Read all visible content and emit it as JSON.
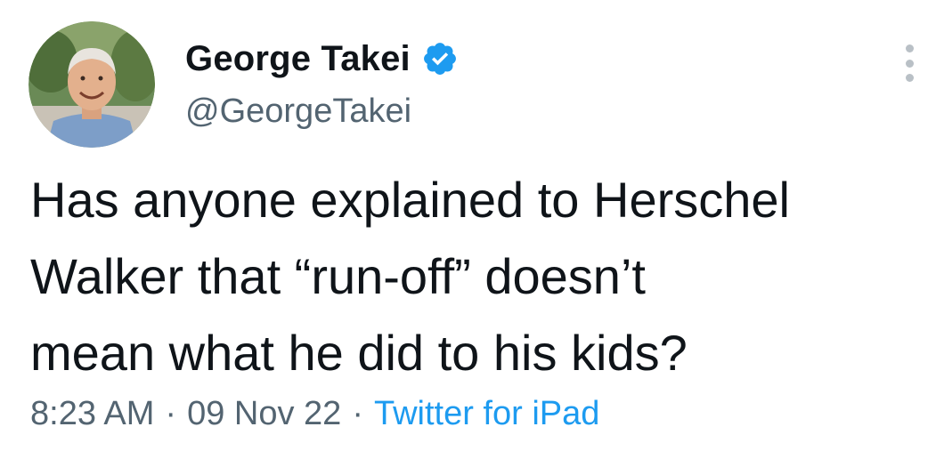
{
  "tweet": {
    "author": {
      "display_name": "George Takei",
      "handle": "@GeorgeTakei",
      "verified": true,
      "avatar_icon": "profile-photo"
    },
    "text": "Has anyone explained to Herschel\nWalker that “run-off” doesn’t\nmean what he did to his kids?",
    "time": "8:23 AM",
    "date": "09 Nov 22",
    "separator": "·",
    "source": "Twitter for iPad",
    "more_icon": "more-vertical-icon"
  },
  "colors": {
    "text": "#0f1419",
    "secondary": "#536471",
    "link": "#1d9bf0",
    "verified": "#1d9bf0"
  }
}
